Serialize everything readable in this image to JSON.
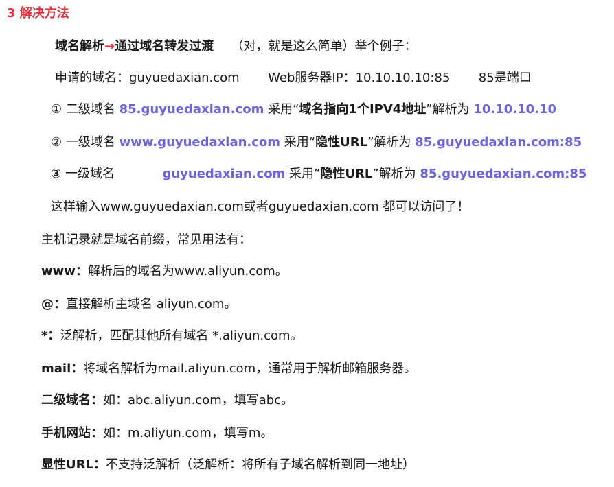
{
  "heading": "3 解决方法",
  "intro": {
    "part1": "域名解析",
    "arrow": "→",
    "part2": "通过域名转发过渡",
    "note": "（对，就是这么简单）举个例子："
  },
  "example": {
    "domain_label": "申请的域名：guyuedaxian.com",
    "server_label": "Web服务器IP：10.10.10.10:85",
    "port_note": "85是端口"
  },
  "rules": [
    {
      "marker": "①",
      "prefix": "二级域名",
      "domain": "85.guyuedaxian.com",
      "use1": "采用“",
      "method": "域名指向1个IPV4地址",
      "use2": "”解析为",
      "target": "10.10.10.10"
    },
    {
      "marker": "②",
      "prefix": "一级域名",
      "domain": "www.guyuedaxian.com",
      "use1": "采用“",
      "method": "隐性URL",
      "use2": "”解析为",
      "target": "85.guyuedaxian.com:85"
    },
    {
      "marker": "③",
      "prefix": "一级域名",
      "domain": "guyuedaxian.com",
      "use1": "采用“",
      "method": "隐性URL",
      "use2": "”解析为",
      "target": "85.guyuedaxian.com:85"
    }
  ],
  "summary": "这样输入www.guyuedaxian.com或者guyuedaxian.com 都可以访问了！",
  "host_record_intro": "主机记录就是域名前缀，常见用法有：",
  "usages": [
    {
      "key": "www：",
      "text": "解析后的域名为www.aliyun.com。"
    },
    {
      "key": "@：",
      "text": "直接解析主域名 aliyun.com。"
    },
    {
      "key": "*：",
      "text": "泛解析，匹配其他所有域名 *.aliyun.com。"
    },
    {
      "key": "mail：",
      "text": "将域名解析为mail.aliyun.com，通常用于解析邮箱服务器。"
    },
    {
      "key": "二级域名：",
      "text": "如：abc.aliyun.com，填写abc。"
    },
    {
      "key": "手机网站：",
      "text": "如：m.aliyun.com，填写m。"
    },
    {
      "key": "显性URL：",
      "text": "不支持泛解析（泛解析：将所有子域名解析到同一地址）"
    }
  ]
}
